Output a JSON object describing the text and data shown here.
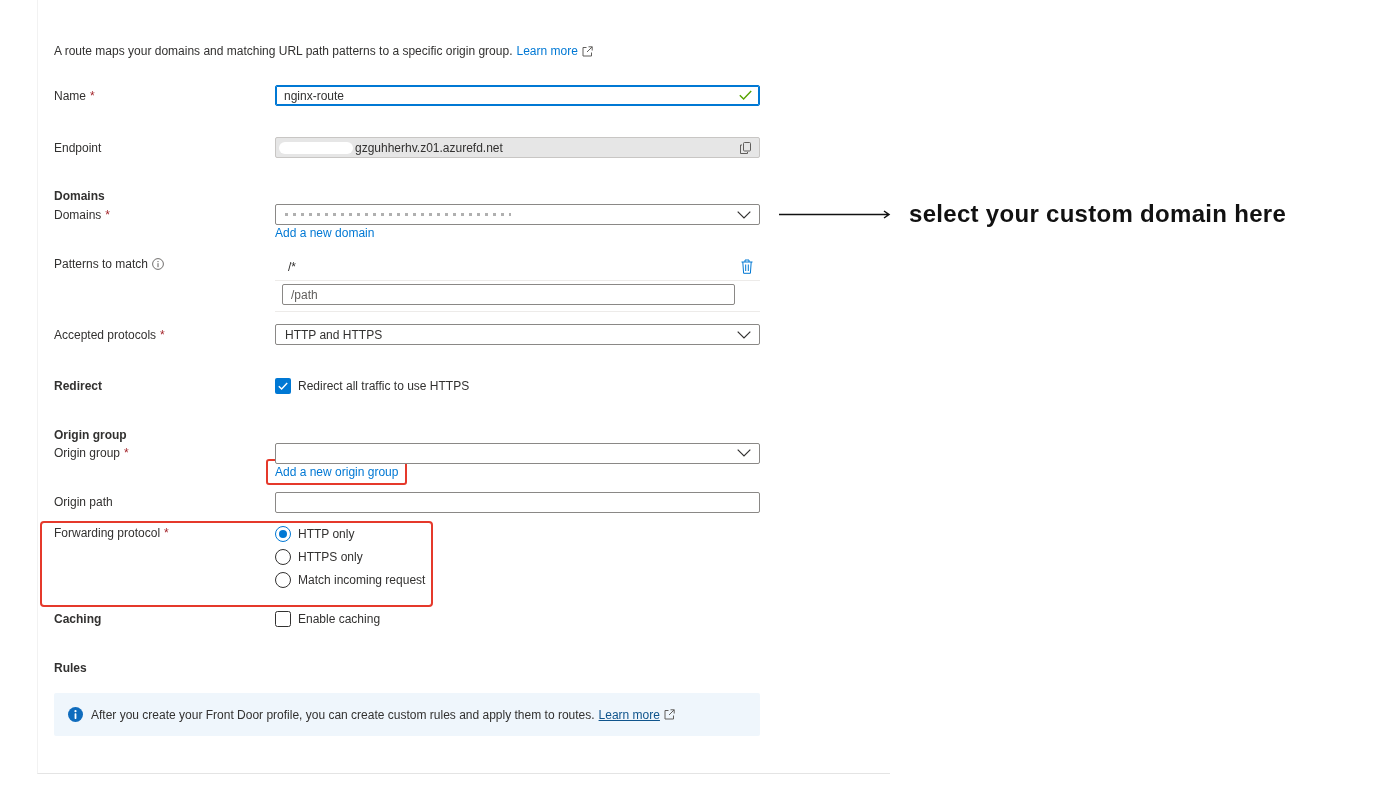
{
  "intro": {
    "text": "A route maps your domains and matching URL path patterns to a specific origin group.",
    "link": "Learn more"
  },
  "fields": [
    {
      "kind": "text",
      "label": "Name",
      "required_mark": "*",
      "value": "nginx-route",
      "focused": true,
      "valid": true
    },
    {
      "kind": "readonly",
      "label": "Endpoint",
      "value": "gzguhherhv.z01.azurefd.net",
      "redacted": true
    },
    {
      "kind": "dropdown",
      "heading": "Domains",
      "label": "Domains",
      "required_mark": "*",
      "redacted": true,
      "link": {
        "text": "Add a new domain",
        "highlighted": false
      },
      "callout": "select your custom domain here"
    },
    {
      "kind": "patterns",
      "label": "Patterns to match",
      "patterns": [
        "/*"
      ],
      "placeholder": "/path"
    },
    {
      "kind": "dropdown",
      "label": "Accepted protocols",
      "required_mark": "*",
      "value": "HTTP and HTTPS"
    },
    {
      "kind": "checkbox",
      "heading": "Redirect",
      "text": "Redirect all traffic to use HTTPS",
      "checked": true
    },
    {
      "kind": "dropdown",
      "heading": "Origin group",
      "label": "Origin group",
      "required_mark": "*",
      "link": {
        "text": "Add a new origin group",
        "highlighted": true
      }
    },
    {
      "kind": "text",
      "label": "Origin path",
      "focused": false,
      "valid": false
    },
    {
      "kind": "radio",
      "label": "Forwarding protocol",
      "required_mark": "*",
      "highlighted": true,
      "options": [
        {
          "label": "HTTP only",
          "selected": true
        },
        {
          "label": "HTTPS only",
          "selected": false
        },
        {
          "label": "Match incoming request",
          "selected": false
        }
      ]
    },
    {
      "kind": "checkbox",
      "heading": "Caching",
      "text": "Enable caching",
      "checked": false
    },
    {
      "kind": "info",
      "heading": "Rules",
      "text": "After you create your Front Door profile, you can create custom rules and apply them to routes.",
      "link": "Learn more"
    }
  ]
}
